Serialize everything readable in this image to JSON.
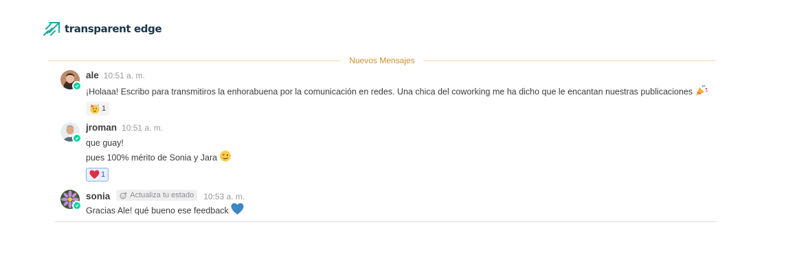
{
  "brand": {
    "name": "transparent edge"
  },
  "divider": {
    "label": "Nuevos Mensajes"
  },
  "posts": [
    {
      "username": "ale",
      "time": "10:51 a. m.",
      "messages": [
        "¡Holaaa! Escribo para transmitiros la enhorabuena por la comunicación en redes. Una chica del coworking me ha dicho que le encantan nuestras publicaciones"
      ],
      "reaction": {
        "emoji": "partying-face",
        "count": "1"
      }
    },
    {
      "username": "jroman",
      "time": "10:51 a. m.",
      "messages": [
        "que guay!",
        "pues 100% mérito de Sonia y Jara"
      ],
      "reaction": {
        "emoji": "red-heart",
        "count": "1"
      }
    },
    {
      "username": "sonia",
      "status_placeholder": "Actualiza tu estado",
      "time": "10:53 a. m.",
      "messages": [
        "Gracias Ale! qué bueno ese feedback"
      ]
    }
  ],
  "colors": {
    "new_messages": "#cc8f2c",
    "online": "#06d6a0",
    "reaction_active_border": "#8cb0e6"
  }
}
